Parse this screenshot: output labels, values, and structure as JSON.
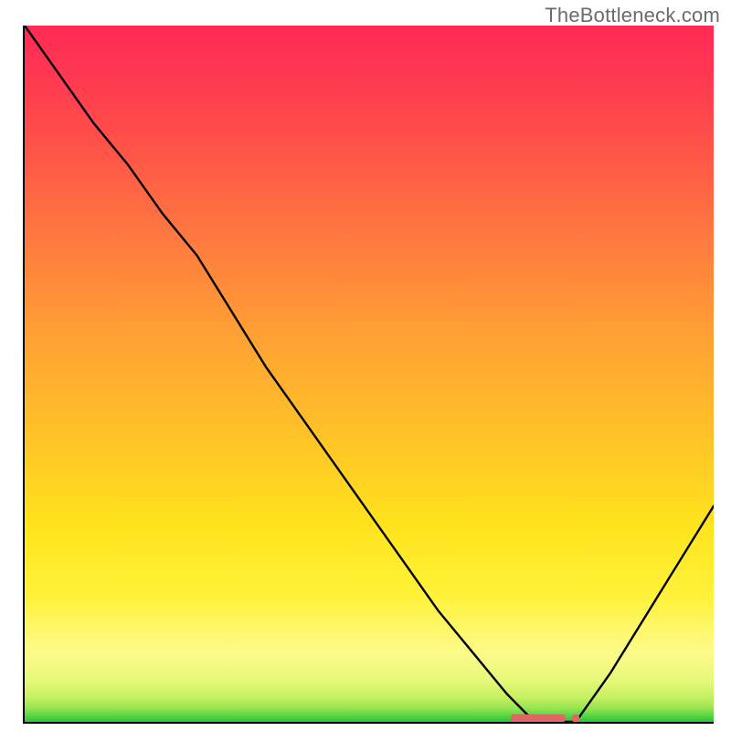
{
  "watermark": "TheBottleneck.com",
  "chart_data": {
    "type": "line",
    "title": "",
    "xlabel": "",
    "ylabel": "",
    "xlim": [
      0,
      100
    ],
    "ylim": [
      0,
      100
    ],
    "grid": false,
    "legend": false,
    "background": "red_to_green_vertical_gradient",
    "series": [
      {
        "name": "bottleneck-curve",
        "x": [
          0,
          5,
          10,
          15,
          20,
          25,
          30,
          35,
          40,
          45,
          50,
          55,
          60,
          65,
          70,
          73,
          76,
          80,
          85,
          90,
          95,
          100
        ],
        "y": [
          100,
          93,
          86,
          80,
          73,
          67,
          59,
          51,
          44,
          37,
          30,
          23,
          16,
          10,
          4,
          1,
          0,
          0,
          7,
          15,
          23,
          31
        ]
      }
    ],
    "marker": {
      "name": "optimal-range",
      "shape": "rounded-bar",
      "color": "#e06666",
      "x_range": [
        70.5,
        78.5
      ],
      "y": 0.5
    }
  }
}
